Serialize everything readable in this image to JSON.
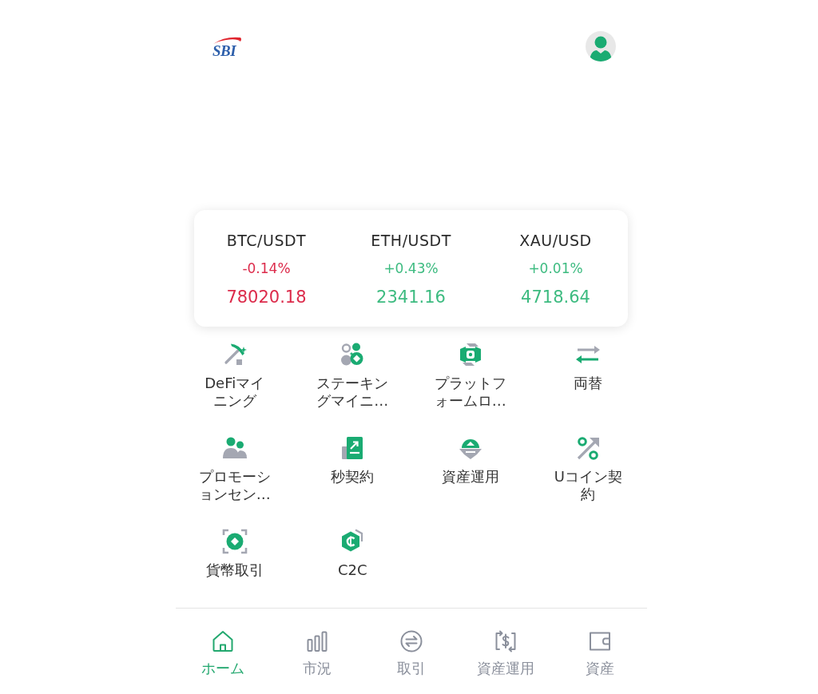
{
  "header": {
    "logo": "SBI"
  },
  "tickers": [
    {
      "pair": "BTC/USDT",
      "change": "-0.14%",
      "price": "78020.18",
      "color": "#dc2b4b"
    },
    {
      "pair": "ETH/USDT",
      "change": "+0.43%",
      "price": "2341.16",
      "color": "#3dbb80"
    },
    {
      "pair": "XAU/USD",
      "change": "+0.01%",
      "price": "4718.64",
      "color": "#3dbb80"
    }
  ],
  "menu": [
    "DeFiマイニング",
    "ステーキングマイニ…",
    "プラットフォームロ…",
    "両替",
    "プロモーションセン…",
    "秒契約",
    "資産運用",
    "Uコイン契約",
    "貨幣取引",
    "C2C"
  ],
  "tab_bar": [
    {
      "label": "ホーム",
      "selected": true
    },
    {
      "label": "市況",
      "selected": false
    },
    {
      "label": "取引",
      "selected": false
    },
    {
      "label": "資産運用",
      "selected": false
    },
    {
      "label": "資産",
      "selected": false
    }
  ]
}
